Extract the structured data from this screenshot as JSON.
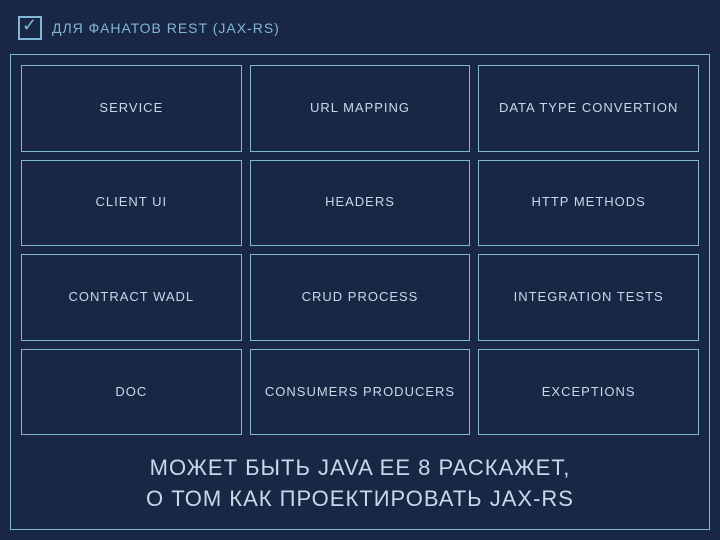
{
  "header": {
    "title": "ДЛЯ ФАНАТОВ REST (JAX-RS)"
  },
  "grid": {
    "cells": [
      {
        "id": "service",
        "label": "SERVICE"
      },
      {
        "id": "url-mapping",
        "label": "URL MAPPING"
      },
      {
        "id": "data-type-convertion",
        "label": "DATA TYPE CONVERTION"
      },
      {
        "id": "client-ui",
        "label": "CLIENT UI"
      },
      {
        "id": "headers",
        "label": "HEADERS"
      },
      {
        "id": "http-methods",
        "label": "HTTP METHODS"
      },
      {
        "id": "contract-wadl",
        "label": "CONTRACT WADL"
      },
      {
        "id": "crud-process",
        "label": "CRUD PROCESS"
      },
      {
        "id": "integration-tests",
        "label": "INTEGRATION TESTS"
      },
      {
        "id": "doc",
        "label": "DOC"
      },
      {
        "id": "consumers-producers",
        "label": "CONSUMERS PRODUCERS"
      },
      {
        "id": "exceptions",
        "label": "EXCEPTIONS"
      }
    ]
  },
  "footer": {
    "line1": "МОЖЕТ БЫТЬ JAVA EE 8  РАСКАЖЕТ,",
    "line2": "О ТОМ КАК ПРОЕКТИРОВАТЬ JAX-RS"
  }
}
